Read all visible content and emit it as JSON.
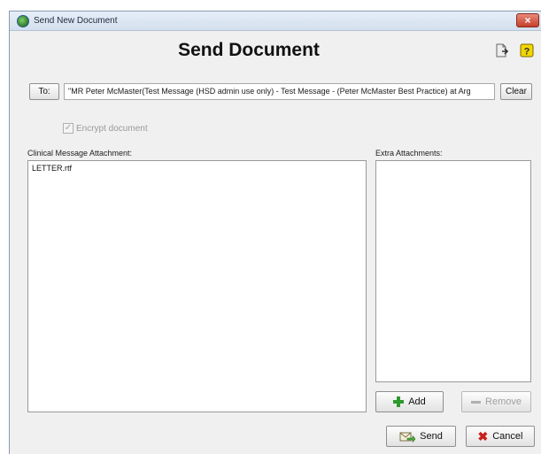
{
  "window": {
    "title": "Send New Document",
    "close_glyph": "×"
  },
  "header": {
    "heading": "Send Document"
  },
  "recipient": {
    "to_label": "To:",
    "to_value": "\"MR Peter McMaster(Test Message (HSD admin use only) - Test Message - (Peter McMaster Best Practice) at Arg",
    "clear_label": "Clear"
  },
  "options": {
    "encrypt_label": "Encrypt document",
    "encrypt_checked": true
  },
  "clinical": {
    "label": "Clinical Message Attachment:",
    "items": [
      "LETTER.rtf"
    ]
  },
  "extra": {
    "label": "Extra Attachments:",
    "add_label": "Add",
    "remove_label": "Remove"
  },
  "actions": {
    "send_label": "Send",
    "cancel_label": "Cancel"
  },
  "icons": {
    "app": "app-icon",
    "export": "export-icon",
    "help": "help-icon",
    "add": "plus-icon",
    "remove": "minus-icon",
    "send": "send-icon",
    "cancel": "cancel-icon"
  },
  "colors": {
    "help_icon": "#f2d600",
    "export_icon": "#e8e8e8",
    "send_icon": "#4fae3a",
    "cancel_icon": "#c8201a"
  }
}
